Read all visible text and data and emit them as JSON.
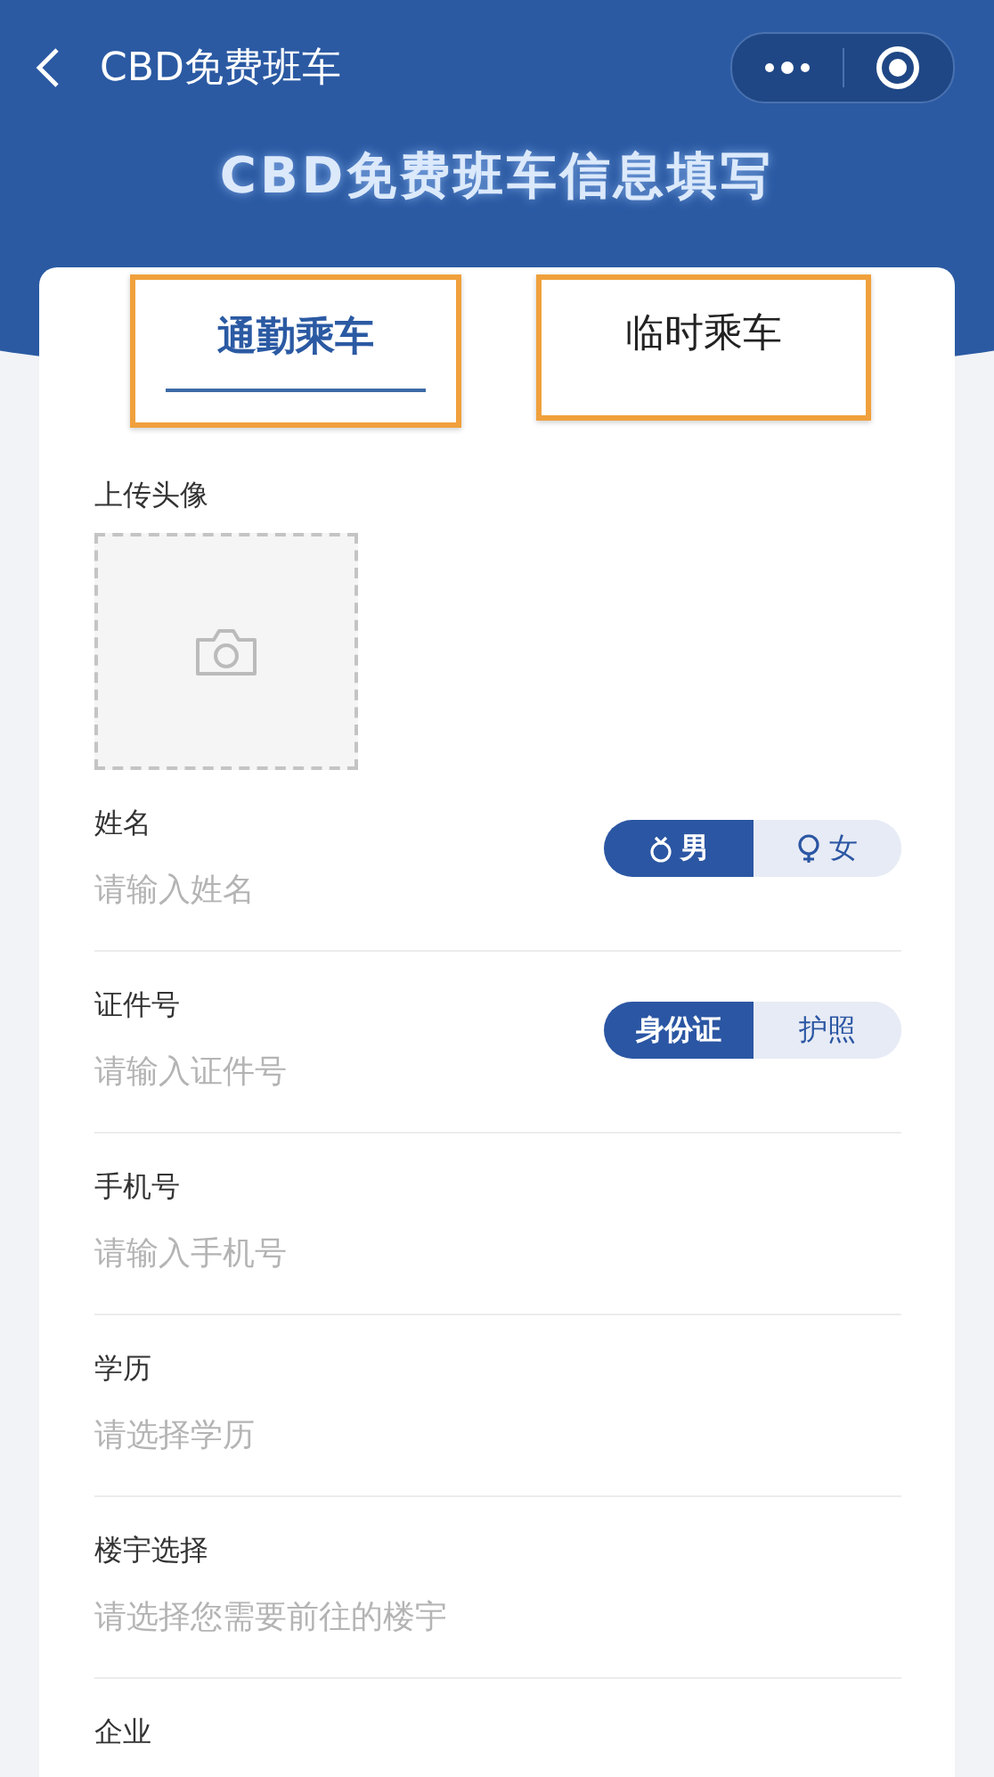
{
  "nav": {
    "title": "CBD免费班车"
  },
  "page_title": "CBD免费班车信息填写",
  "tabs": [
    {
      "label": "通勤乘车",
      "selected": true
    },
    {
      "label": "临时乘车",
      "selected": false
    }
  ],
  "avatar": {
    "label": "上传头像"
  },
  "fields": [
    {
      "label": "姓名",
      "placeholder": "请输入姓名",
      "options": [
        {
          "label": "男",
          "kind": "male",
          "selected": true
        },
        {
          "label": "女",
          "kind": "female",
          "selected": false
        }
      ]
    },
    {
      "label": "证件号",
      "placeholder": "请输入证件号",
      "options": [
        {
          "label": "身份证",
          "selected": true
        },
        {
          "label": "护照",
          "selected": false
        }
      ]
    },
    {
      "label": "手机号",
      "placeholder": "请输入手机号"
    },
    {
      "label": "学历",
      "placeholder": "请选择学历"
    },
    {
      "label": "楼宇选择",
      "placeholder": "请选择您需要前往的楼宇"
    },
    {
      "label": "企业"
    }
  ]
}
